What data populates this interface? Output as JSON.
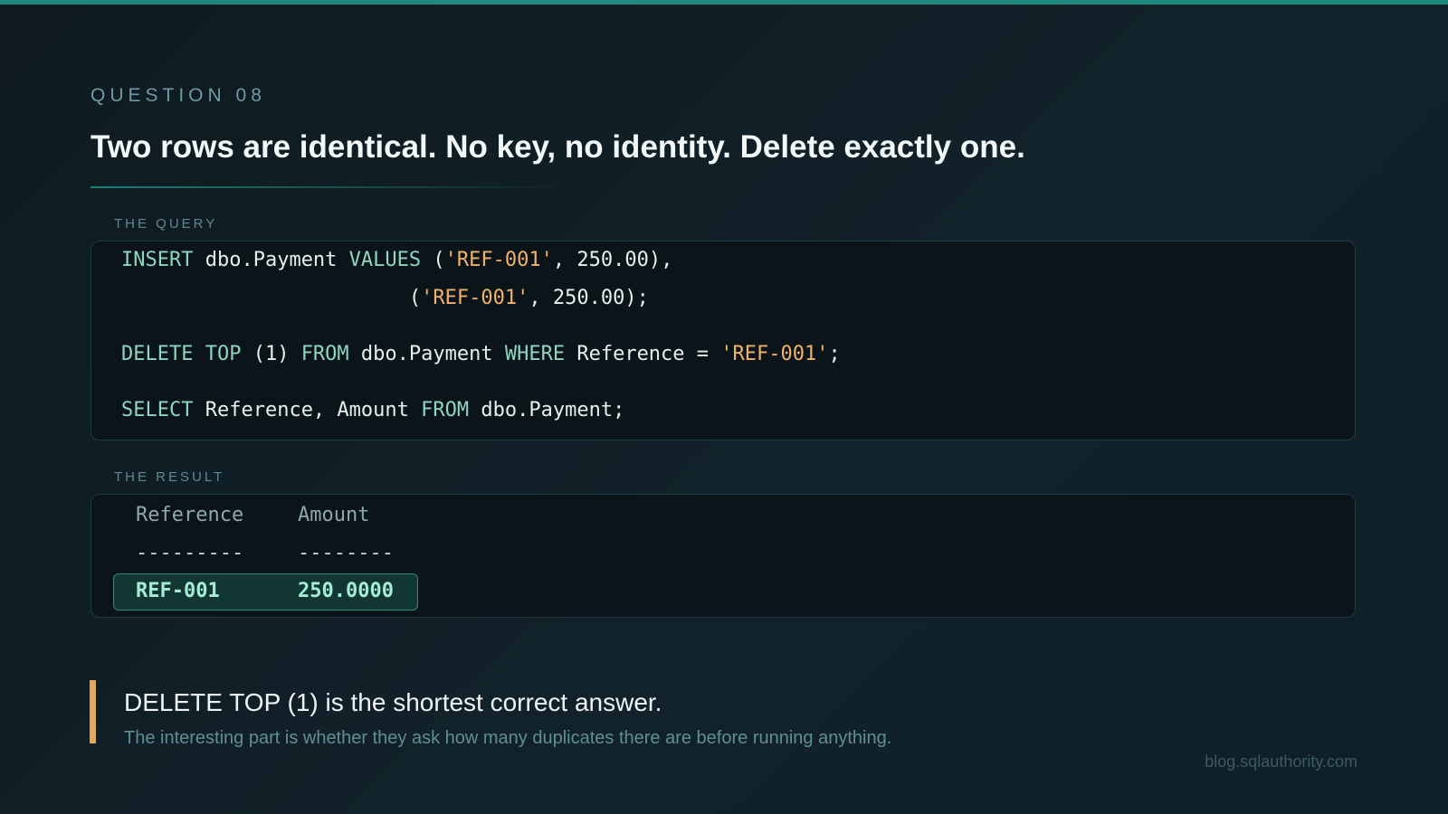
{
  "eyebrow": "QUESTION 08",
  "title": "Two rows are identical. No key, no identity. Delete exactly one.",
  "query": {
    "label": "THE QUERY",
    "lines": [
      [
        {
          "t": "INSERT",
          "c": "kw"
        },
        {
          "t": " dbo.Payment ",
          "c": ""
        },
        {
          "t": "VALUES",
          "c": "kw"
        },
        {
          "t": " (",
          "c": ""
        },
        {
          "t": "'REF-001'",
          "c": "str"
        },
        {
          "t": ", 250.00),",
          "c": ""
        }
      ],
      [
        {
          "t": "                        (",
          "c": ""
        },
        {
          "t": "'REF-001'",
          "c": "str"
        },
        {
          "t": ", 250.00);",
          "c": ""
        }
      ],
      [
        {
          "t": "DELETE TOP",
          "c": "kw"
        },
        {
          "t": " (1) ",
          "c": ""
        },
        {
          "t": "FROM",
          "c": "kw"
        },
        {
          "t": " dbo.Payment ",
          "c": ""
        },
        {
          "t": "WHERE",
          "c": "kw"
        },
        {
          "t": " Reference = ",
          "c": ""
        },
        {
          "t": "'REF-001'",
          "c": "str"
        },
        {
          "t": ";",
          "c": ""
        }
      ],
      [
        {
          "t": "SELECT",
          "c": "kw"
        },
        {
          "t": " Reference, Amount ",
          "c": ""
        },
        {
          "t": "FROM",
          "c": "kw"
        },
        {
          "t": " dbo.Payment;",
          "c": ""
        }
      ]
    ]
  },
  "result": {
    "label": "THE RESULT",
    "columns": [
      "Reference",
      "Amount"
    ],
    "dashes": [
      "---------",
      "--------"
    ],
    "rows": [
      [
        "REF-001",
        "250.0000"
      ]
    ]
  },
  "callout": {
    "main": "DELETE TOP (1) is the shortest correct answer.",
    "sub": "The interesting part is whether they ask how many duplicates there are before running anything."
  },
  "watermark": "blog.sqlauthority.com",
  "colors": {
    "accent": "#1d8a7d",
    "keyword": "#8fd5c4",
    "string": "#f0b26b",
    "callout_bar": "#e8a85a",
    "result_highlight": "#a4ecd8"
  }
}
